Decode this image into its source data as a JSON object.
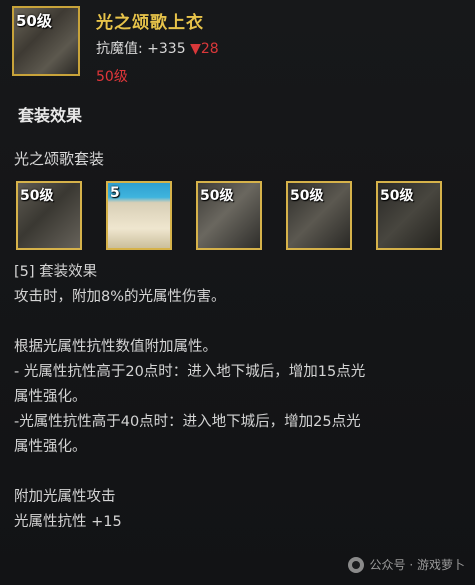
{
  "item": {
    "name": "光之颂歌上衣",
    "level_tag": "50级",
    "stat_label": "抗魔值:",
    "stat_value": "+335",
    "stat_down": "▼28",
    "required_level": "50级"
  },
  "section_title": "套装效果",
  "set": {
    "name": "光之颂歌套装",
    "pieces": [
      {
        "level_tag": "50级",
        "icon": "jacket-icon"
      },
      {
        "level_tag": "5",
        "icon": "pants-icon"
      },
      {
        "level_tag": "50级",
        "icon": "shoulder-icon"
      },
      {
        "level_tag": "50级",
        "icon": "belt-icon"
      },
      {
        "level_tag": "50级",
        "icon": "shoes-icon"
      }
    ]
  },
  "effects": [
    "[5] 套装效果",
    "攻击时，附加8%的光属性伤害。",
    "",
    "根据光属性抗性数值附加属性。",
    "- 光属性抗性高于20点时：进入地下城后，增加15点光",
    "属性强化。",
    "-光属性抗性高于40点时：进入地下城后，增加25点光",
    "属性强化。",
    "",
    "附加光属性攻击",
    "光属性抗性 +15"
  ],
  "watermark": "公众号 · 游戏萝卜"
}
